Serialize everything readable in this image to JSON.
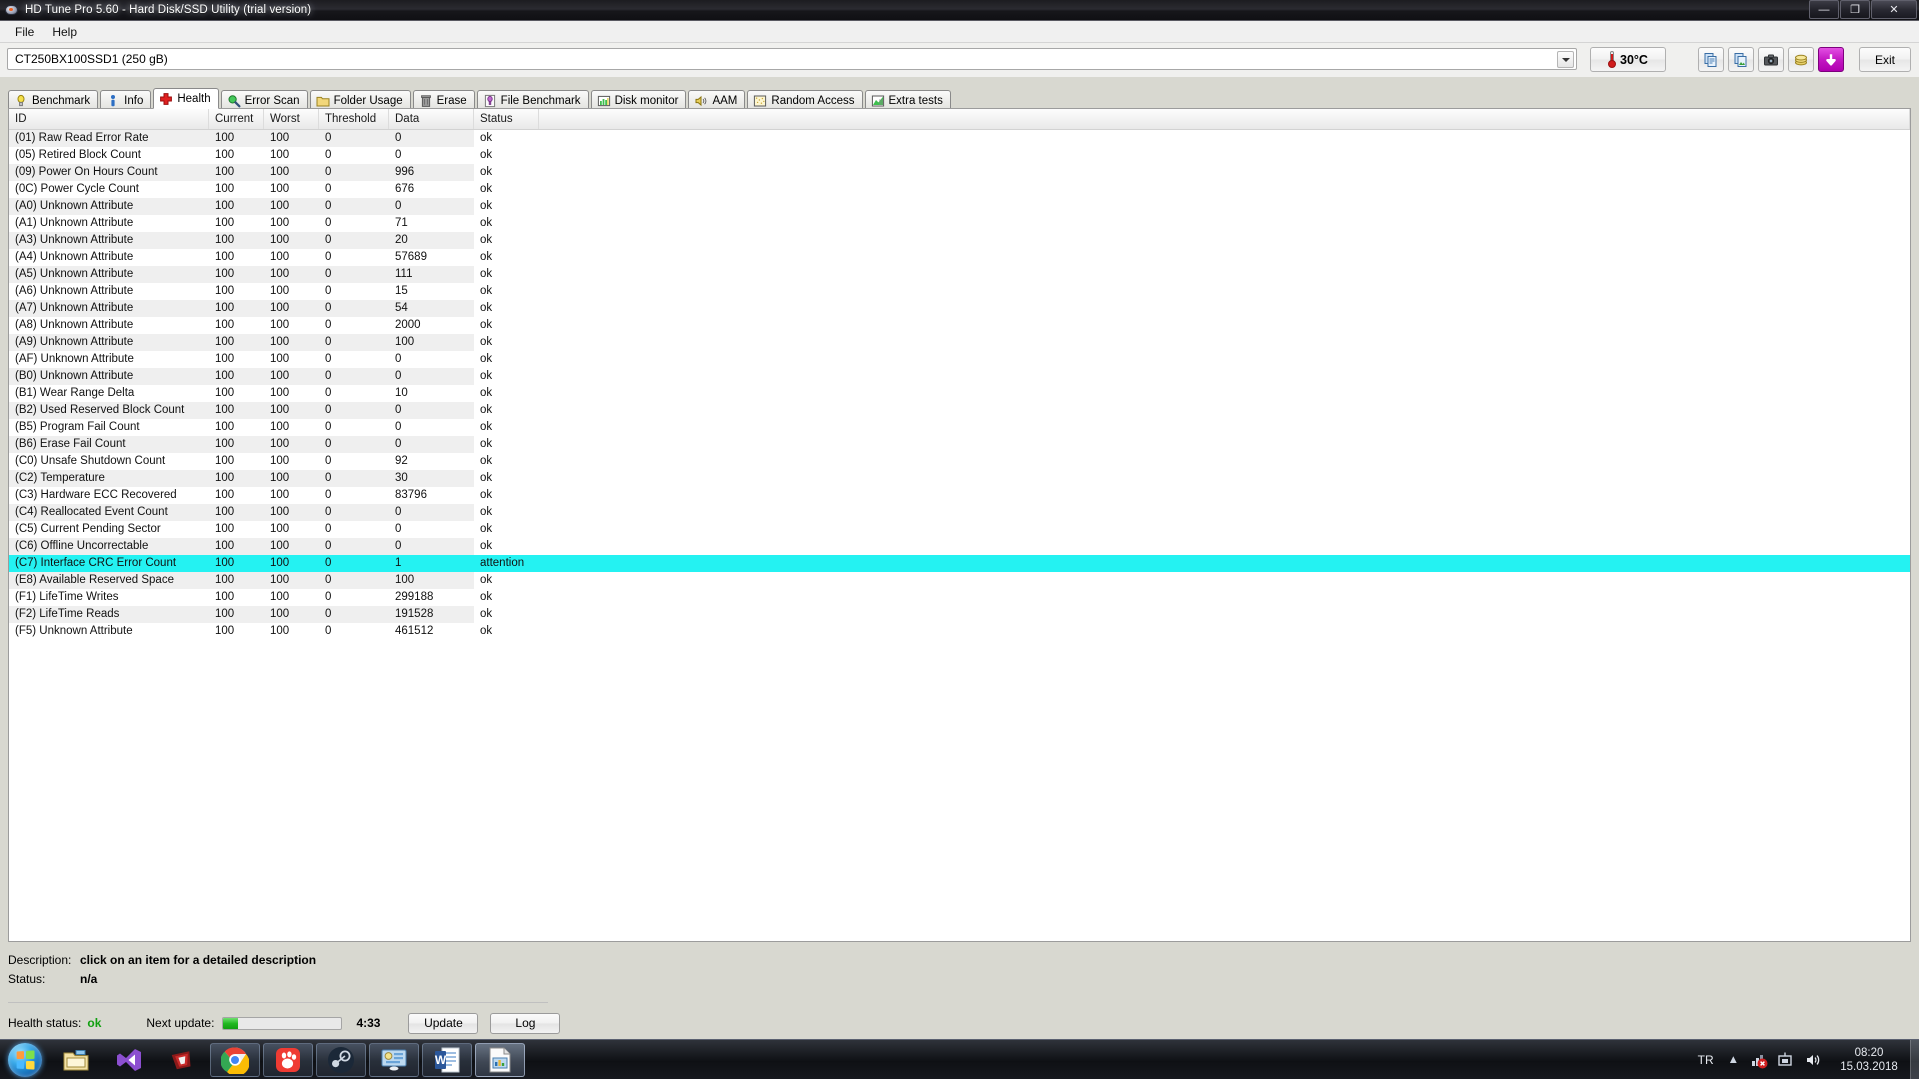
{
  "window": {
    "title": "HD Tune Pro 5.60 - Hard Disk/SSD Utility (trial version)",
    "icon": "hd-tune-app-icon",
    "minimize": "—",
    "maximize": "❐",
    "close": "✕"
  },
  "menubar": {
    "items": [
      {
        "label": "File"
      },
      {
        "label": "Help"
      }
    ]
  },
  "toolbar": {
    "device": {
      "value": "CT250BX100SSD1 (250 gB)",
      "icon": "chevron-down-icon"
    },
    "temperature": {
      "value": "30°C",
      "icon": "thermometer-icon"
    },
    "buttons": [
      {
        "name": "copy-to-clipboard-button",
        "icon": "copy-icon"
      },
      {
        "name": "copy-image-button",
        "icon": "copy-image-icon"
      },
      {
        "name": "screenshot-button",
        "icon": "camera-icon"
      },
      {
        "name": "disk-info-button",
        "icon": "coins-icon"
      },
      {
        "name": "save-button",
        "icon": "download-arrow-icon"
      }
    ],
    "exit_label": "Exit"
  },
  "tabs": [
    {
      "label": "Benchmark",
      "icon": "lightbulb-icon",
      "active": false
    },
    {
      "label": "Info",
      "icon": "info-person-icon",
      "active": false
    },
    {
      "label": "Health",
      "icon": "red-cross-icon",
      "active": true
    },
    {
      "label": "Error Scan",
      "icon": "magnifier-icon",
      "active": false
    },
    {
      "label": "Folder Usage",
      "icon": "folder-icon",
      "active": false
    },
    {
      "label": "Erase",
      "icon": "trashcan-icon",
      "active": false
    },
    {
      "label": "File Benchmark",
      "icon": "file-clock-icon",
      "active": false
    },
    {
      "label": "Disk monitor",
      "icon": "bar-chart-icon",
      "active": false
    },
    {
      "label": "AAM",
      "icon": "speaker-icon",
      "active": false
    },
    {
      "label": "Random Access",
      "icon": "dots-icon",
      "active": false
    },
    {
      "label": "Extra tests",
      "icon": "chart-green-icon",
      "active": false
    }
  ],
  "smart_table": {
    "columns": [
      "ID",
      "Current",
      "Worst",
      "Threshold",
      "Data",
      "Status"
    ],
    "rows": [
      {
        "id": "(01) Raw Read Error Rate",
        "current": "100",
        "worst": "100",
        "threshold": "0",
        "data": "0",
        "status": "ok"
      },
      {
        "id": "(05) Retired Block Count",
        "current": "100",
        "worst": "100",
        "threshold": "0",
        "data": "0",
        "status": "ok"
      },
      {
        "id": "(09) Power On Hours Count",
        "current": "100",
        "worst": "100",
        "threshold": "0",
        "data": "996",
        "status": "ok"
      },
      {
        "id": "(0C) Power Cycle Count",
        "current": "100",
        "worst": "100",
        "threshold": "0",
        "data": "676",
        "status": "ok"
      },
      {
        "id": "(A0) Unknown Attribute",
        "current": "100",
        "worst": "100",
        "threshold": "0",
        "data": "0",
        "status": "ok"
      },
      {
        "id": "(A1) Unknown Attribute",
        "current": "100",
        "worst": "100",
        "threshold": "0",
        "data": "71",
        "status": "ok"
      },
      {
        "id": "(A3) Unknown Attribute",
        "current": "100",
        "worst": "100",
        "threshold": "0",
        "data": "20",
        "status": "ok"
      },
      {
        "id": "(A4) Unknown Attribute",
        "current": "100",
        "worst": "100",
        "threshold": "0",
        "data": "57689",
        "status": "ok"
      },
      {
        "id": "(A5) Unknown Attribute",
        "current": "100",
        "worst": "100",
        "threshold": "0",
        "data": "111",
        "status": "ok"
      },
      {
        "id": "(A6) Unknown Attribute",
        "current": "100",
        "worst": "100",
        "threshold": "0",
        "data": "15",
        "status": "ok"
      },
      {
        "id": "(A7) Unknown Attribute",
        "current": "100",
        "worst": "100",
        "threshold": "0",
        "data": "54",
        "status": "ok"
      },
      {
        "id": "(A8) Unknown Attribute",
        "current": "100",
        "worst": "100",
        "threshold": "0",
        "data": "2000",
        "status": "ok"
      },
      {
        "id": "(A9) Unknown Attribute",
        "current": "100",
        "worst": "100",
        "threshold": "0",
        "data": "100",
        "status": "ok"
      },
      {
        "id": "(AF) Unknown Attribute",
        "current": "100",
        "worst": "100",
        "threshold": "0",
        "data": "0",
        "status": "ok"
      },
      {
        "id": "(B0) Unknown Attribute",
        "current": "100",
        "worst": "100",
        "threshold": "0",
        "data": "0",
        "status": "ok"
      },
      {
        "id": "(B1) Wear Range Delta",
        "current": "100",
        "worst": "100",
        "threshold": "0",
        "data": "10",
        "status": "ok"
      },
      {
        "id": "(B2) Used Reserved Block Count",
        "current": "100",
        "worst": "100",
        "threshold": "0",
        "data": "0",
        "status": "ok"
      },
      {
        "id": "(B5) Program Fail Count",
        "current": "100",
        "worst": "100",
        "threshold": "0",
        "data": "0",
        "status": "ok"
      },
      {
        "id": "(B6) Erase Fail Count",
        "current": "100",
        "worst": "100",
        "threshold": "0",
        "data": "0",
        "status": "ok"
      },
      {
        "id": "(C0) Unsafe Shutdown Count",
        "current": "100",
        "worst": "100",
        "threshold": "0",
        "data": "92",
        "status": "ok"
      },
      {
        "id": "(C2) Temperature",
        "current": "100",
        "worst": "100",
        "threshold": "0",
        "data": "30",
        "status": "ok"
      },
      {
        "id": "(C3) Hardware ECC Recovered",
        "current": "100",
        "worst": "100",
        "threshold": "0",
        "data": "83796",
        "status": "ok"
      },
      {
        "id": "(C4) Reallocated Event Count",
        "current": "100",
        "worst": "100",
        "threshold": "0",
        "data": "0",
        "status": "ok"
      },
      {
        "id": "(C5) Current Pending Sector",
        "current": "100",
        "worst": "100",
        "threshold": "0",
        "data": "0",
        "status": "ok"
      },
      {
        "id": "(C6) Offline Uncorrectable",
        "current": "100",
        "worst": "100",
        "threshold": "0",
        "data": "0",
        "status": "ok"
      },
      {
        "id": "(C7) Interface CRC Error Count",
        "current": "100",
        "worst": "100",
        "threshold": "0",
        "data": "1",
        "status": "attention",
        "highlight": true
      },
      {
        "id": "(E8) Available Reserved Space",
        "current": "100",
        "worst": "100",
        "threshold": "0",
        "data": "100",
        "status": "ok"
      },
      {
        "id": "(F1) LifeTime Writes",
        "current": "100",
        "worst": "100",
        "threshold": "0",
        "data": "299188",
        "status": "ok"
      },
      {
        "id": "(F2) LifeTime Reads",
        "current": "100",
        "worst": "100",
        "threshold": "0",
        "data": "191528",
        "status": "ok"
      },
      {
        "id": "(F5) Unknown Attribute",
        "current": "100",
        "worst": "100",
        "threshold": "0",
        "data": "461512",
        "status": "ok"
      }
    ]
  },
  "details": {
    "description_label": "Description:",
    "description_value": "click on an item for a detailed description",
    "status_label": "Status:",
    "status_value": "n/a"
  },
  "statusbar": {
    "health_label": "Health status:",
    "health_value": "ok",
    "next_update_label": "Next update:",
    "progress_percent": 12,
    "eta": "4:33",
    "update_label": "Update",
    "log_label": "Log"
  },
  "taskbar": {
    "start_icon": "windows-start-orb",
    "items": [
      {
        "name": "explorer",
        "icon": "folder-explorer-icon",
        "state": "pinned"
      },
      {
        "name": "visual-studio",
        "icon": "visual-studio-icon",
        "state": "pinned"
      },
      {
        "name": "ruby",
        "icon": "ruby-gem-icon",
        "state": "pinned"
      },
      {
        "name": "google-chrome",
        "icon": "chrome-icon",
        "state": "running"
      },
      {
        "name": "gom-player",
        "icon": "gom-player-icon",
        "state": "running"
      },
      {
        "name": "steam",
        "icon": "steam-icon",
        "state": "running"
      },
      {
        "name": "control-panel",
        "icon": "control-panel-icon",
        "state": "running"
      },
      {
        "name": "microsoft-word",
        "icon": "word-icon",
        "state": "running"
      },
      {
        "name": "hd-tune-pro",
        "icon": "hd-tune-icon",
        "state": "active"
      }
    ],
    "tray": {
      "language": "TR",
      "show_hidden_icon": "chevron-up-icon",
      "icons": [
        "network-error-icon",
        "action-center-icon",
        "volume-icon"
      ],
      "time": "08:20",
      "date": "15.03.2018"
    }
  },
  "colors": {
    "attention_row": "#24f2f2",
    "health_ok": "#10a010",
    "save_button": "#c319c3",
    "progress_fill": "#22b822"
  }
}
